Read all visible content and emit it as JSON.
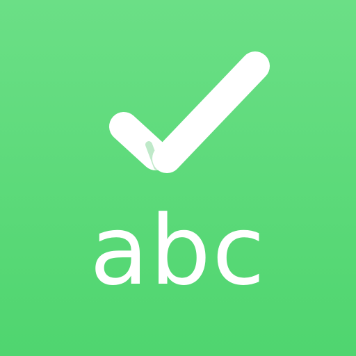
{
  "app_icon": {
    "word": "abc",
    "icon_name": "checkmark-icon",
    "colors": {
      "background_top": "#6bdf86",
      "background_bottom": "#4fd56f",
      "foreground": "#ffffff",
      "crease": "#bfe9c9"
    }
  }
}
